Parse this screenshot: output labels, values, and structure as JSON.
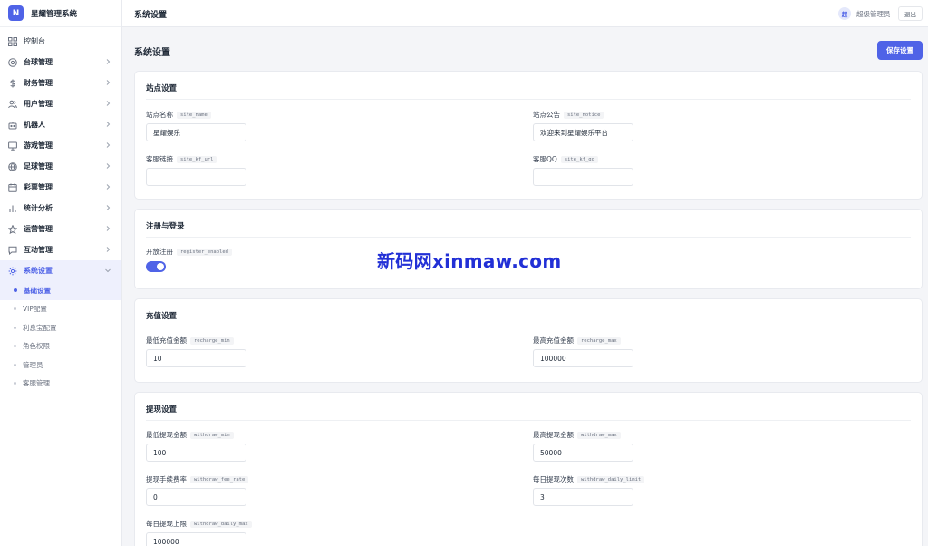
{
  "brand": {
    "logo_letter": "N",
    "name": "星耀管理系统"
  },
  "topbar": {
    "title": "系统设置",
    "avatar_text": "超",
    "user_name": "超级管理员",
    "logout": "退出"
  },
  "page": {
    "title": "系统设置",
    "save_button": "保存设置"
  },
  "sidebar": {
    "items": [
      {
        "label": "控制台",
        "icon": "grid-icon"
      },
      {
        "label": "台球管理",
        "icon": "target-icon"
      },
      {
        "label": "财务管理",
        "icon": "dollar-icon"
      },
      {
        "label": "用户管理",
        "icon": "users-icon"
      },
      {
        "label": "机器人",
        "icon": "robot-icon"
      },
      {
        "label": "游戏管理",
        "icon": "monitor-icon"
      },
      {
        "label": "足球管理",
        "icon": "globe-icon"
      },
      {
        "label": "彩票管理",
        "icon": "calendar-icon"
      },
      {
        "label": "统计分析",
        "icon": "bar-chart-icon"
      },
      {
        "label": "运营管理",
        "icon": "star-icon"
      },
      {
        "label": "互动管理",
        "icon": "message-icon"
      },
      {
        "label": "系统设置",
        "icon": "gear-icon"
      }
    ],
    "sub_items": [
      {
        "label": "基础设置"
      },
      {
        "label": "VIP配置"
      },
      {
        "label": "利息宝配置"
      },
      {
        "label": "角色权限"
      },
      {
        "label": "管理员"
      },
      {
        "label": "客服管理"
      }
    ]
  },
  "sections": {
    "site": {
      "title": "站点设置",
      "fields": [
        {
          "label": "站点名称",
          "key": "site_name",
          "value": "星耀娱乐"
        },
        {
          "label": "站点公告",
          "key": "site_notice",
          "value": "欢迎来到星耀娱乐平台"
        },
        {
          "label": "客服链接",
          "key": "site_kf_url",
          "value": ""
        },
        {
          "label": "客服QQ",
          "key": "site_kf_qq",
          "value": ""
        }
      ]
    },
    "register": {
      "title": "注册与登录",
      "fields": [
        {
          "label": "开放注册",
          "key": "register_enabled",
          "value": "on"
        }
      ]
    },
    "recharge": {
      "title": "充值设置",
      "fields": [
        {
          "label": "最低充值金额",
          "key": "recharge_min",
          "value": "10"
        },
        {
          "label": "最高充值金额",
          "key": "recharge_max",
          "value": "100000"
        }
      ]
    },
    "withdraw": {
      "title": "提现设置",
      "fields": [
        {
          "label": "最低提现金额",
          "key": "withdraw_min",
          "value": "100"
        },
        {
          "label": "最高提现金额",
          "key": "withdraw_max",
          "value": "50000"
        },
        {
          "label": "提现手续费率",
          "key": "withdraw_fee_rate",
          "value": "0"
        },
        {
          "label": "每日提现次数",
          "key": "withdraw_daily_limit",
          "value": "3"
        },
        {
          "label": "每日提现上限",
          "key": "withdraw_daily_max",
          "value": "100000"
        }
      ]
    }
  },
  "watermark": "新码网xinmaw.com",
  "colors": {
    "accent": "#4f63e7",
    "background": "#f4f5f8",
    "card": "#ffffff"
  }
}
